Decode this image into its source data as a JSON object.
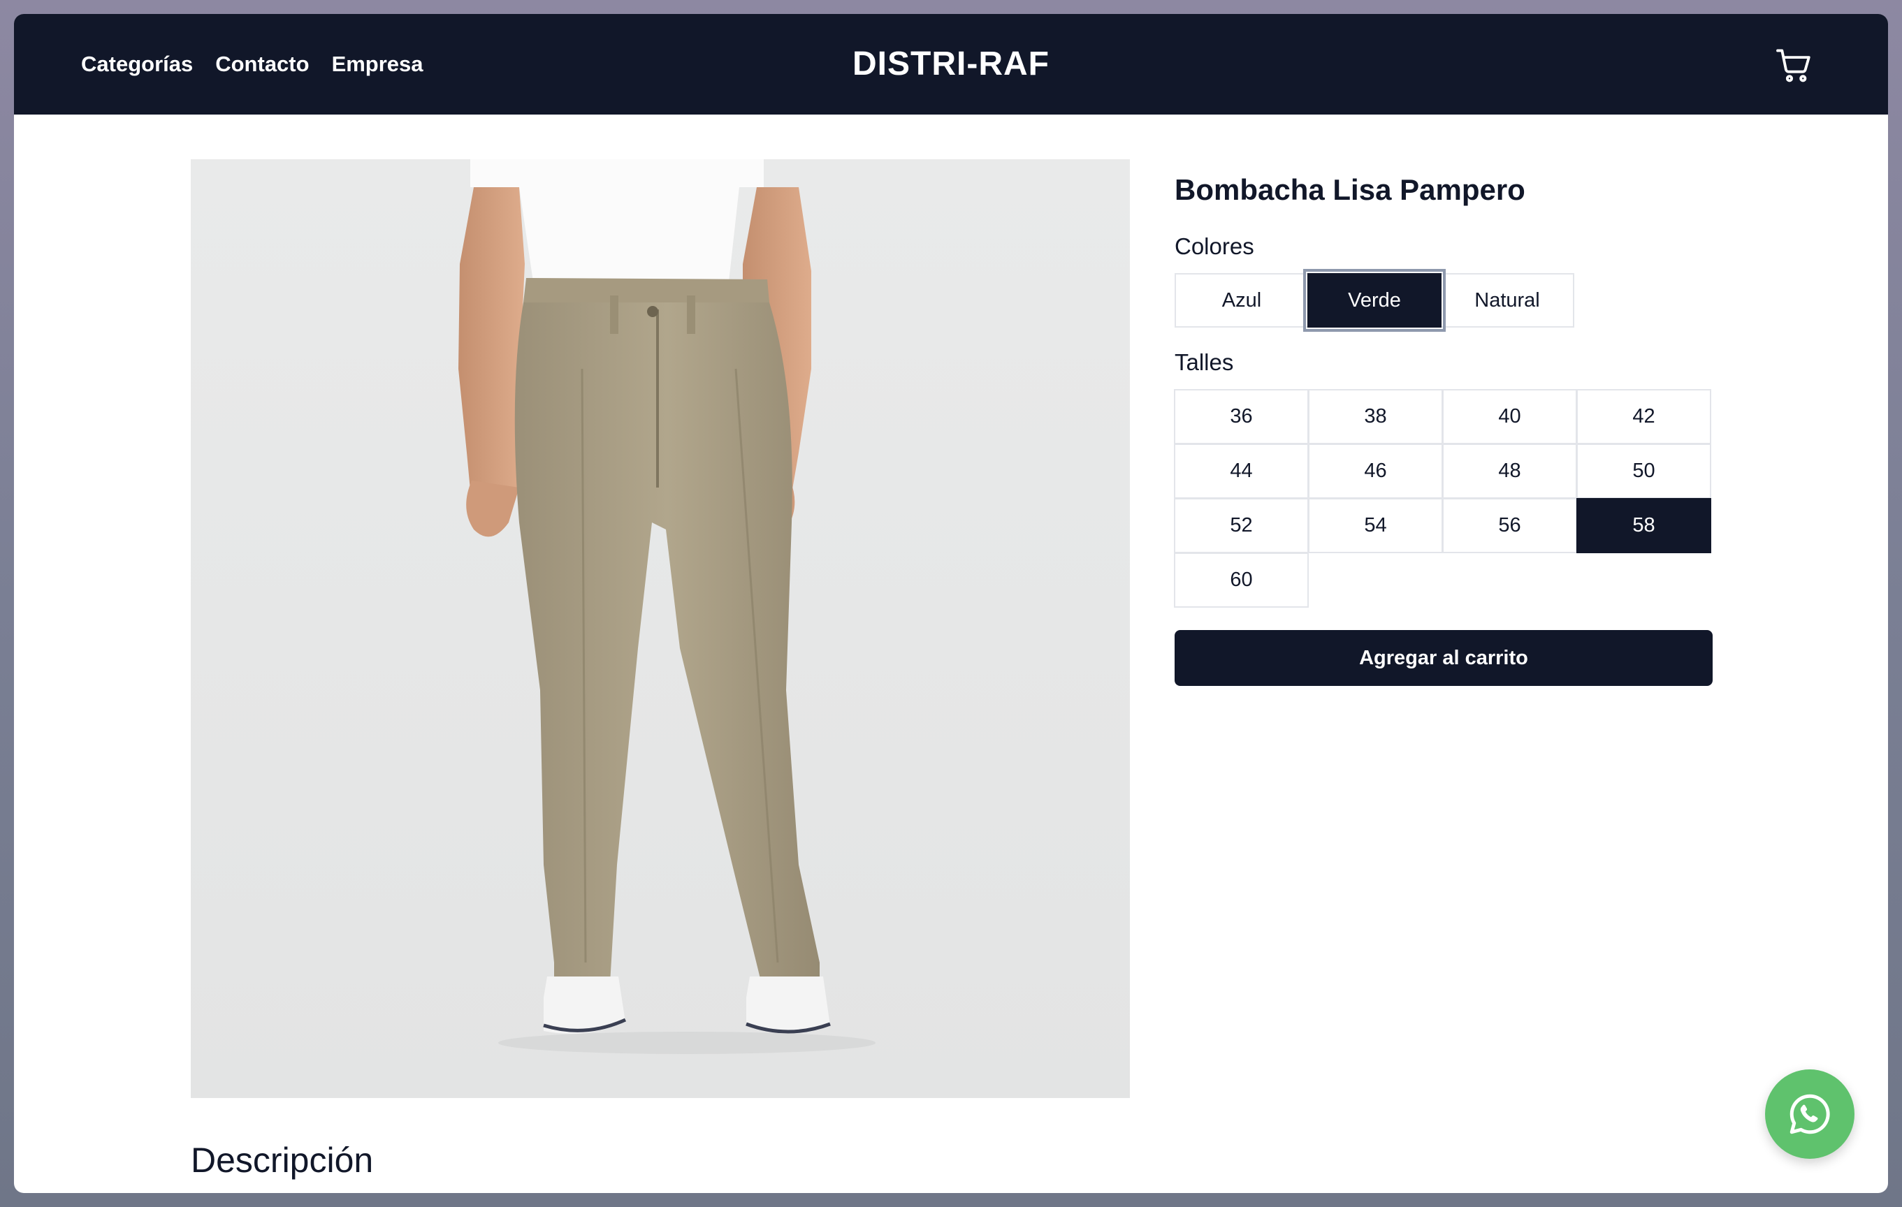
{
  "header": {
    "nav_links": [
      "Categorías",
      "Contacto",
      "Empresa"
    ],
    "brand": "DISTRI-RAF",
    "cart_icon": "shopping-cart-icon"
  },
  "product": {
    "title": "Bombacha Lisa Pampero",
    "image": "khaki-pleated-trousers-photo",
    "colors_label": "Colores",
    "colors": [
      {
        "label": "Azul",
        "selected": false
      },
      {
        "label": "Verde",
        "selected": true
      },
      {
        "label": "Natural",
        "selected": false
      }
    ],
    "sizes_label": "Talles",
    "sizes": [
      {
        "label": "36",
        "selected": false
      },
      {
        "label": "38",
        "selected": false
      },
      {
        "label": "40",
        "selected": false
      },
      {
        "label": "42",
        "selected": false
      },
      {
        "label": "44",
        "selected": false
      },
      {
        "label": "46",
        "selected": false
      },
      {
        "label": "48",
        "selected": false
      },
      {
        "label": "50",
        "selected": false
      },
      {
        "label": "52",
        "selected": false
      },
      {
        "label": "54",
        "selected": false
      },
      {
        "label": "56",
        "selected": false
      },
      {
        "label": "58",
        "selected": true
      },
      {
        "label": "60",
        "selected": false
      }
    ],
    "add_to_cart_label": "Agregar al carrito",
    "description_heading": "Descripción"
  },
  "whatsapp": {
    "icon": "whatsapp-icon"
  },
  "colors": {
    "primary": "#111729",
    "whatsapp_green": "#5fc26d",
    "border": "#e3e5ea"
  }
}
